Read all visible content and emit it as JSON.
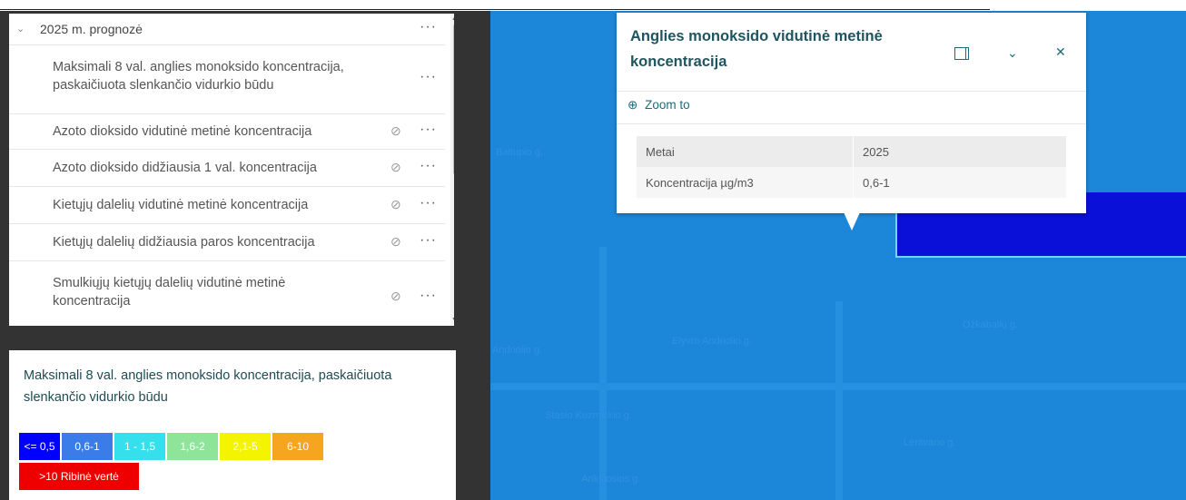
{
  "layer_list": {
    "group": {
      "title": "2025 m. prognozė",
      "chevron_icon": "chevron-down-icon",
      "more_icon": "more-icon"
    },
    "layers": [
      {
        "label": "Maksimali 8 val. anglies monoksido koncentracija, paskaičiuota slenkančio vidurkio būdu",
        "hidden": false
      },
      {
        "label": "Azoto dioksido vidutinė metinė koncentracija",
        "hidden": true
      },
      {
        "label": "Azoto dioksido didžiausia 1 val. koncentracija",
        "hidden": true
      },
      {
        "label": "Kietųjų dalelių vidutinė metinė koncentracija",
        "hidden": true
      },
      {
        "label": "Kietųjų dalelių didžiausia paros koncentracija",
        "hidden": true
      },
      {
        "label": "Smulkiųjų kietųjų dalelių vidutinė metinė koncentracija",
        "hidden": true
      }
    ],
    "visibility_icon": "eye-off-icon"
  },
  "legend": {
    "title": "Maksimali 8 val. anglies monoksido koncentracija, paskaičiuota slenkančio vidurkio būdu",
    "classes": [
      {
        "label": "<= 0,5",
        "color": "#0000ff"
      },
      {
        "label": "0,6-1",
        "color": "#3a7de8"
      },
      {
        "label": "1 - 1,5",
        "color": "#35e0ec"
      },
      {
        "label": "1,6-2",
        "color": "#8ee59a"
      },
      {
        "label": "2,1-5",
        "color": "#f4f400"
      },
      {
        "label": "6-10",
        "color": "#f5a51e"
      },
      {
        "label": ">10 Ribinė vertė",
        "color": "#ee0000"
      }
    ]
  },
  "popup": {
    "title": "Anglies monoksido vidutinė metinė koncentracija",
    "zoom_label": "Zoom to",
    "fields": [
      {
        "name": "Metai",
        "value": "2025"
      },
      {
        "name": "Koncentracija µg/m3",
        "value": "0,6-1"
      }
    ]
  },
  "map": {
    "streets": [
      "Baltupio g.",
      "Andriolio g.",
      "Elyvro Andriolio g.",
      "Ožkabalių g.",
      "Lentvario g.",
      "Stasio Kuzmickio g.",
      "Ankštosios g."
    ]
  }
}
